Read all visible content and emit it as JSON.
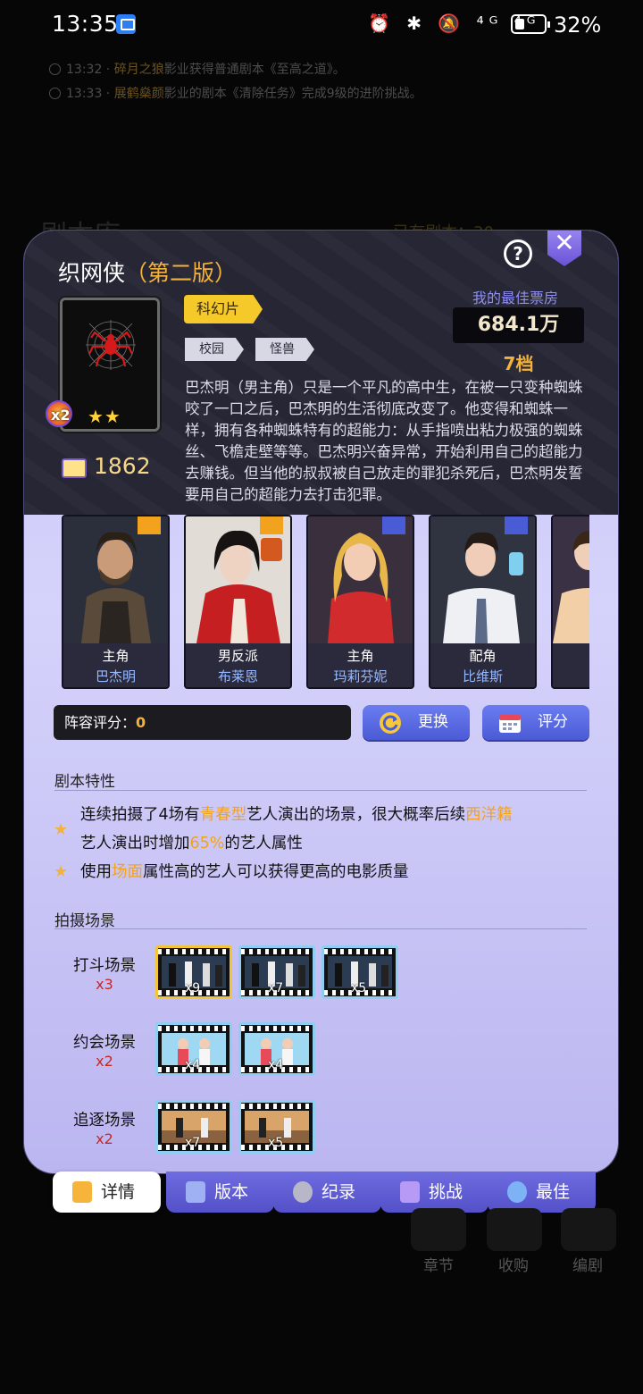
{
  "status_bar": {
    "time": "13:35",
    "icons": "⏰ ✱ 🔕 ⁴ᴳ ⁴ᴳ",
    "battery": "32%"
  },
  "ticker": [
    {
      "time": "13:32",
      "name": "碎月之狼",
      "text": "影业获得普通剧本《至高之道》。"
    },
    {
      "time": "13:33",
      "name": "展鹤燊颜",
      "text": "影业的剧本《清除任务》完成9级的进阶挑战。"
    }
  ],
  "background": {
    "title": "剧本库",
    "right_text": "已有剧本：30"
  },
  "script": {
    "title": "织网侠",
    "version": "（第二版）",
    "star_count": 2,
    "stars": "★★",
    "badge": "x2",
    "reads": "1862",
    "genre": "科幻片",
    "tags": [
      "校园",
      "怪兽"
    ],
    "description": "巴杰明（男主角）只是一个平凡的高中生，在被一只变种蜘蛛咬了一口之后，巴杰明的生活彻底改变了。他变得和蜘蛛一样，拥有各种蜘蛛特有的超能力：从手指喷出粘力极强的蜘蛛丝、飞檐走壁等等。巴杰明兴奋异常，开始利用自己的超能力去赚钱。但当他的叔叔被自己放走的罪犯杀死后，巴杰明发誓要用自己的超能力去打击犯罪。",
    "box_office_label": "我的最佳票房",
    "box_office_value": "684.1万",
    "tier": "7档"
  },
  "cast": [
    {
      "role": "主角",
      "name": "巴杰明",
      "corner": "#f3a21e"
    },
    {
      "role": "男反派",
      "name": "布莱恩",
      "corner": "#f3a21e"
    },
    {
      "role": "主角",
      "name": "玛莉芬妮",
      "corner": "#4a5bd6"
    },
    {
      "role": "配角",
      "name": "比维斯",
      "corner": "#4a5bd6"
    },
    {
      "role": "",
      "name": "",
      "corner": "#4a5bd6"
    }
  ],
  "lineup": {
    "label": "阵容评分：",
    "value": "0",
    "swap_label": "更换",
    "rate_label": "评分"
  },
  "traits_section": {
    "title": "剧本特性",
    "trait1": {
      "a": "连续拍摄了4场有",
      "b": "青春型",
      "c": "艺人演出的场景，很大概率后续",
      "d": "西洋籍",
      "e": "艺人演出时增加",
      "f": "65%",
      "g": "的艺人属性"
    },
    "trait2": {
      "a": "使用",
      "b": "场面",
      "c": "属性高的艺人可以获得更高的电影质量"
    }
  },
  "scenes_section": {
    "title": "拍摄场景",
    "scenes": [
      {
        "label": "打斗场景",
        "mult": "x3",
        "films": [
          {
            "count": "x9",
            "gold": true
          },
          {
            "count": "x7",
            "gold": false
          },
          {
            "count": "x5",
            "gold": false
          }
        ]
      },
      {
        "label": "约会场景",
        "mult": "x2",
        "films": [
          {
            "count": "x4",
            "gold": false
          },
          {
            "count": "x4",
            "gold": false
          }
        ]
      },
      {
        "label": "追逐场景",
        "mult": "x2",
        "films": [
          {
            "count": "x7",
            "gold": false
          },
          {
            "count": "x5",
            "gold": false
          }
        ]
      }
    ]
  },
  "tabs": [
    "详情",
    "版本",
    "纪录",
    "挑战",
    "最佳"
  ],
  "bottom_nav": [
    "章节",
    "收购",
    "编剧"
  ],
  "colors": {
    "accent_gold": "#f3b23a",
    "panel_lavender": "#cbc9f8",
    "tab_purple": "#6f6ce0"
  }
}
